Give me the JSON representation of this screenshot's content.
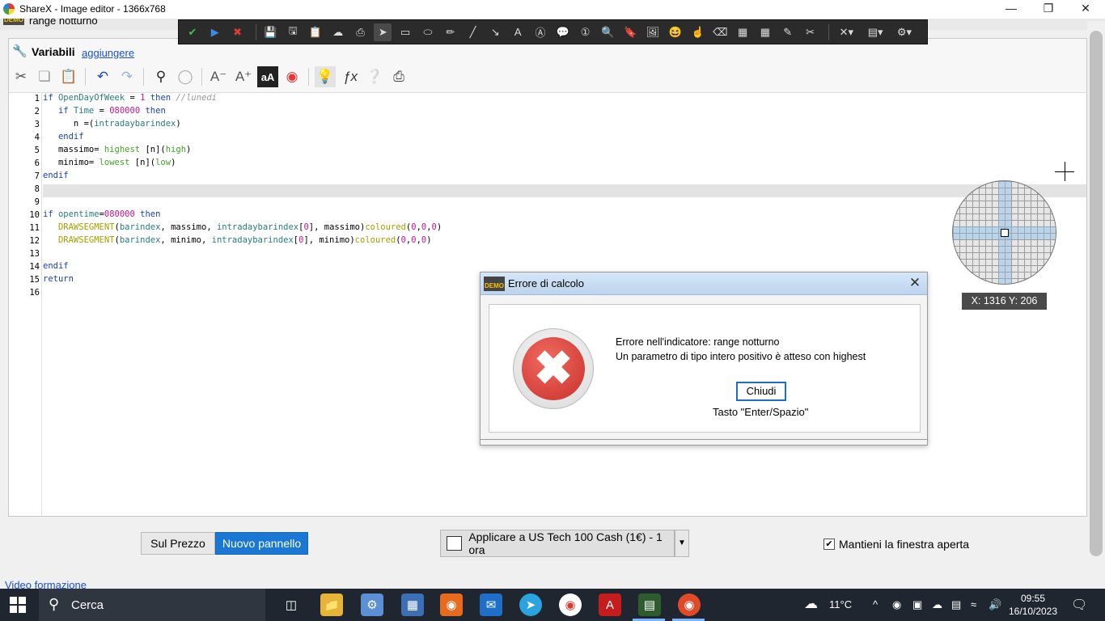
{
  "window": {
    "title": "ShareX - Image editor - 1366x768",
    "under_title": "range notturno",
    "demo_badge": "DEMO"
  },
  "panel": {
    "variables_label": "Variabili",
    "add_link": "aggiungere"
  },
  "code": {
    "line_numbers": [
      "1",
      "2",
      "3",
      "4",
      "5",
      "6",
      "7",
      "8",
      "9",
      "10",
      "11",
      "12",
      "13",
      "14",
      "15",
      "16"
    ],
    "lines": {
      "l1": [
        "if",
        " ",
        "OpenDayOfWeek",
        " = ",
        "1",
        " ",
        "then",
        " ",
        "//lunedi"
      ],
      "l2": [
        "   ",
        "if",
        " ",
        "Time",
        " = ",
        "080000",
        " ",
        "then"
      ],
      "l3": [
        "      n =(",
        "intradaybarindex",
        ")"
      ],
      "l4": [
        "   ",
        "endif"
      ],
      "l5": [
        "   massimo= ",
        "highest",
        " [n](",
        "high",
        ")"
      ],
      "l6": [
        "   minimo= ",
        "lowest",
        " [n](",
        "low",
        ")"
      ],
      "l7": [
        "endif"
      ],
      "l10": [
        "if",
        " ",
        "opentime",
        "=",
        "080000",
        " ",
        "then"
      ],
      "l11": [
        "   ",
        "DRAWSEGMENT",
        "(",
        "barindex",
        ", massimo, ",
        "intradaybarindex",
        "[",
        "0",
        "], massimo)",
        "coloured",
        "(",
        "0",
        ",",
        "0",
        ",",
        "0",
        ")"
      ],
      "l12": [
        "   ",
        "DRAWSEGMENT",
        "(",
        "barindex",
        ", minimo, ",
        "intradaybarindex",
        "[",
        "0",
        "], minimo)",
        "coloured",
        "(",
        "0",
        ",",
        "0",
        ",",
        "0",
        ")"
      ],
      "l14": [
        "endif"
      ],
      "l15": [
        "return"
      ]
    }
  },
  "bottom": {
    "on_price": "Sul Prezzo",
    "new_panel": "Nuovo pannello",
    "apply": "Applicare a US Tech 100 Cash (1€) - 1 ora",
    "keep_open": "Mantieni la finestra aperta",
    "keep_open_checked": true,
    "video_link": "Video formazione"
  },
  "dialog": {
    "title": "Errore di calcolo",
    "message_line1": "Errore nell'indicatore: range notturno",
    "message_line2": "Un parametro di tipo intero positivo è atteso con highest",
    "close_button": "Chiudi",
    "hint": "Tasto \"Enter/Spazio\""
  },
  "magnifier": {
    "coords": "X: 1316 Y: 206"
  },
  "taskbar": {
    "search_label": "Cerca",
    "weather": "11°C",
    "time": "09:55",
    "date": "16/10/2023"
  },
  "colors": {
    "accent_blue": "#1a78d4",
    "toolbar_dark": "#2b2b2b",
    "error_red": "#d9443c",
    "taskbar": "#1f2630"
  }
}
